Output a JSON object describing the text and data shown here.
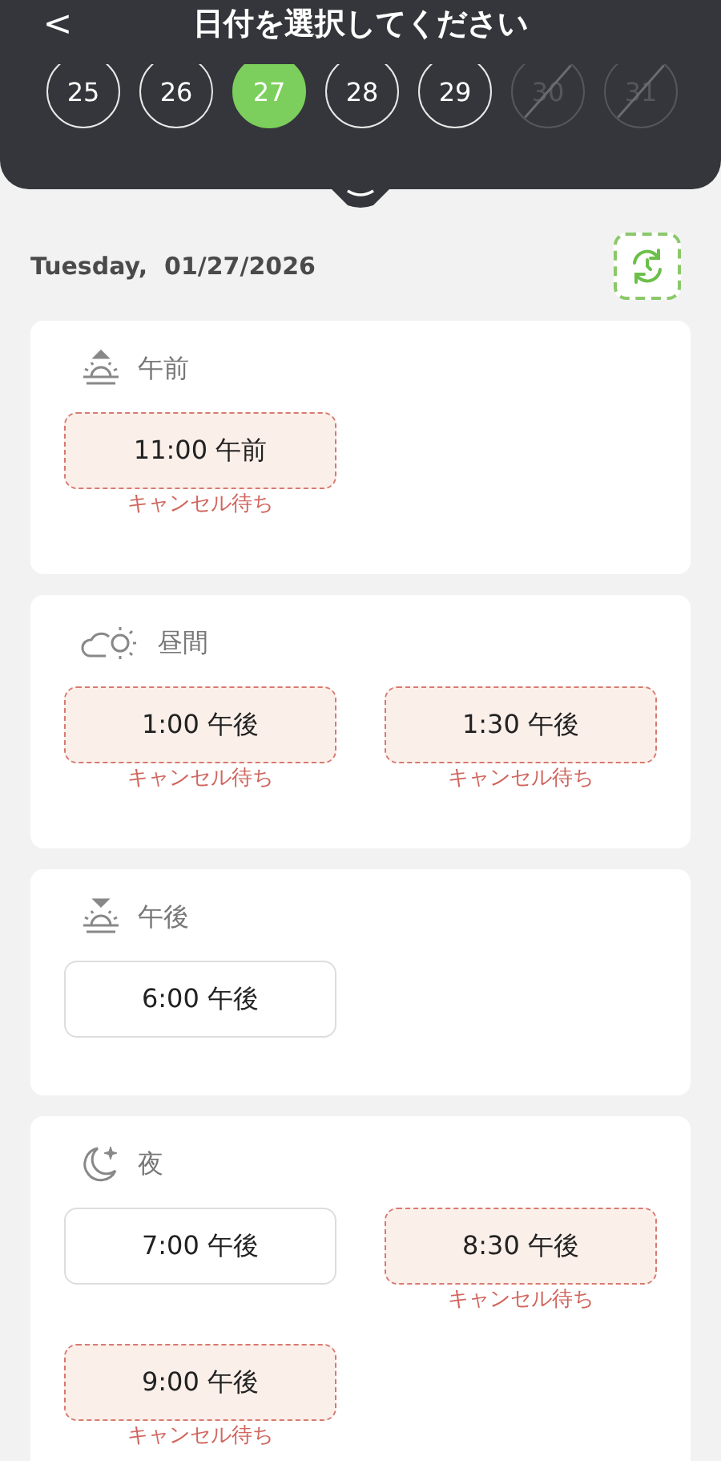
{
  "header": {
    "back": "<",
    "title": "日付を選択してください"
  },
  "days": [
    {
      "label": "25",
      "selected": false,
      "disabled": false
    },
    {
      "label": "26",
      "selected": false,
      "disabled": false
    },
    {
      "label": "27",
      "selected": true,
      "disabled": false
    },
    {
      "label": "28",
      "selected": false,
      "disabled": false
    },
    {
      "label": "29",
      "selected": false,
      "disabled": false
    },
    {
      "label": "30",
      "selected": false,
      "disabled": true
    },
    {
      "label": "31",
      "selected": false,
      "disabled": true
    }
  ],
  "date_line": "Tuesday,  01/27/2026",
  "periods": [
    {
      "kind": "morning",
      "label": "午前",
      "slots": [
        {
          "time": "11:00 午前",
          "waitlist": true,
          "status": "キャンセル待ち"
        }
      ]
    },
    {
      "kind": "midday",
      "label": "昼間",
      "slots": [
        {
          "time": "1:00 午後",
          "waitlist": true,
          "status": "キャンセル待ち"
        },
        {
          "time": "1:30 午後",
          "waitlist": true,
          "status": "キャンセル待ち"
        }
      ]
    },
    {
      "kind": "afternoon",
      "label": "午後",
      "slots": [
        {
          "time": "6:00 午後",
          "waitlist": false
        }
      ]
    },
    {
      "kind": "night",
      "label": "夜",
      "slots": [
        {
          "time": "7:00 午後",
          "waitlist": false
        },
        {
          "time": "8:30 午後",
          "waitlist": true,
          "status": "キャンセル待ち"
        },
        {
          "time": "9:00 午後",
          "waitlist": true,
          "status": "キャンセル待ち"
        }
      ]
    }
  ]
}
